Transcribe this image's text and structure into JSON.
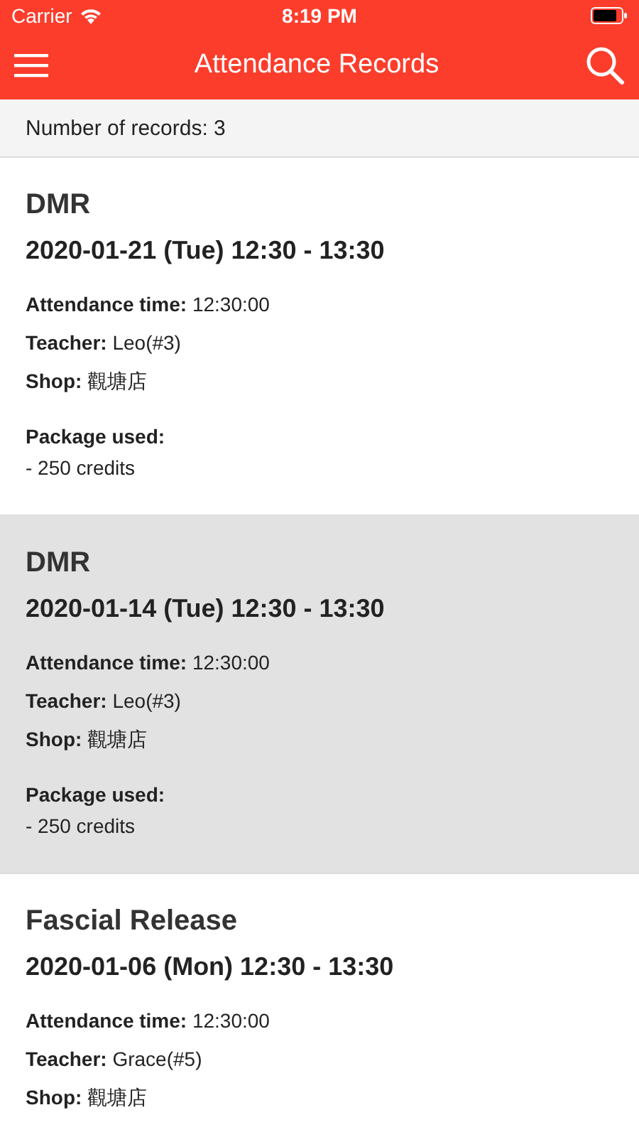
{
  "status_bar": {
    "carrier": "Carrier",
    "time": "8:19 PM"
  },
  "nav_bar": {
    "title": "Attendance Records"
  },
  "summary": "Number of records: 3",
  "records": [
    {
      "selected": false,
      "title": "DMR",
      "datetime": "2020-01-21 (Tue) 12:30 - 13:30",
      "details": [
        "**Attendance time:** 12:30:00",
        "**Teacher:** Leo(#3)",
        "**Shop:** 觀塘店"
      ],
      "package_label": "Package used:",
      "package_value": "- 250 credits"
    },
    {
      "selected": true,
      "title": "DMR",
      "datetime": "2020-01-14 (Tue) 12:30 - 13:30",
      "details": [
        "**Attendance time:** 12:30:00",
        "**Teacher:** Leo(#3)",
        "**Shop:** 觀塘店"
      ],
      "package_label": "Package used:",
      "package_value": "- 250 credits"
    },
    {
      "selected": false,
      "title": "Fascial Release",
      "datetime": "2020-01-06 (Mon) 12:30 - 13:30",
      "details": [
        "**Attendance time:** 12:30:00",
        "**Teacher:** Grace(#5)",
        "**Shop:** 觀塘店"
      ]
    }
  ]
}
